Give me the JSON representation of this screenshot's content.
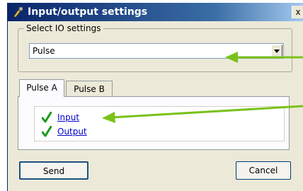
{
  "window": {
    "title": "Input/output settings",
    "close_label": "x"
  },
  "io_group": {
    "legend": "Select IO settings",
    "select": {
      "value": "Pulse"
    }
  },
  "tabs": [
    {
      "label": "Pulse A",
      "active": true
    },
    {
      "label": "Pulse B",
      "active": false
    }
  ],
  "list": {
    "items": [
      {
        "label": "Input",
        "checked": true
      },
      {
        "label": "Output",
        "checked": true
      }
    ]
  },
  "buttons": {
    "send_label": "Send",
    "cancel_label": "Cancel"
  },
  "colors": {
    "accent_arrow": "#7ac21a",
    "check": "#1c9a1c",
    "link": "#0000cc"
  }
}
